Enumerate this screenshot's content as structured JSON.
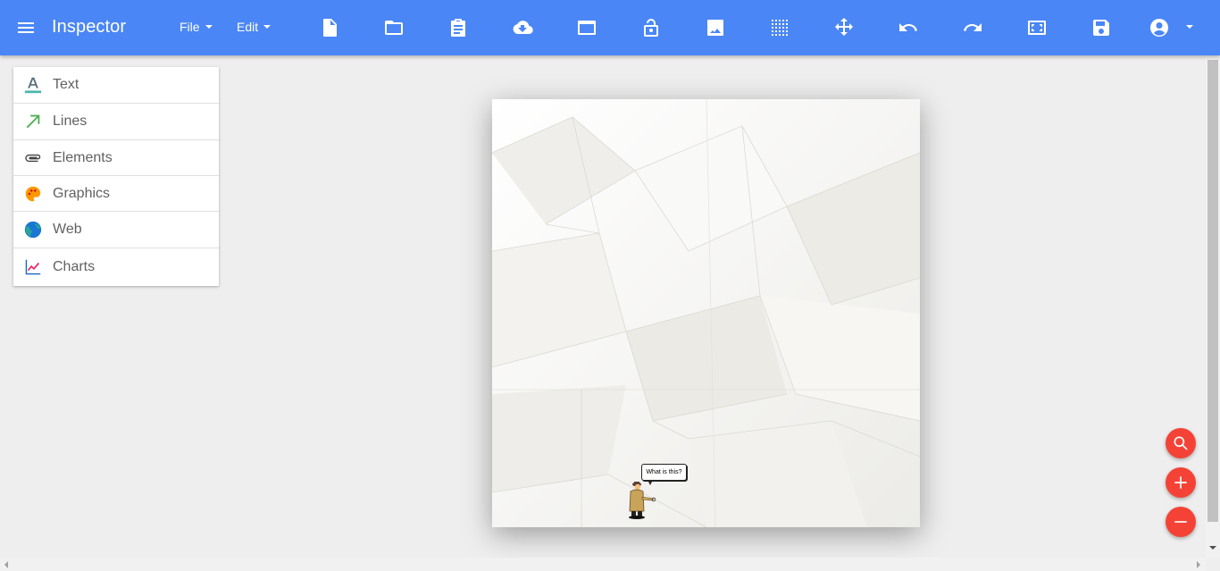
{
  "app": {
    "title": "Inspector"
  },
  "menus": {
    "file": "File",
    "edit": "Edit"
  },
  "toolbar": {
    "tools": [
      {
        "name": "new-document-icon"
      },
      {
        "name": "open-folder-icon"
      },
      {
        "name": "clipboard-icon"
      },
      {
        "name": "cloud-download-icon"
      },
      {
        "name": "window-icon"
      },
      {
        "name": "lock-open-icon"
      },
      {
        "name": "image-icon"
      },
      {
        "name": "grid-icon"
      },
      {
        "name": "move-icon"
      },
      {
        "name": "undo-icon"
      },
      {
        "name": "redo-icon"
      },
      {
        "name": "fit-screen-icon"
      },
      {
        "name": "save-icon"
      },
      {
        "name": "account-circle-icon"
      }
    ]
  },
  "sidebar": {
    "items": [
      {
        "label": "Text",
        "icon": "text-icon",
        "color": "#4db6ac"
      },
      {
        "label": "Lines",
        "icon": "arrow-line-icon",
        "color": "#4caf50"
      },
      {
        "label": "Elements",
        "icon": "paperclip-icon",
        "color": "#616161"
      },
      {
        "label": "Graphics",
        "icon": "palette-icon",
        "color": "#ff9800"
      },
      {
        "label": "Web",
        "icon": "globe-icon",
        "color": "#1976d2"
      },
      {
        "label": "Charts",
        "icon": "line-chart-icon",
        "color": "#e91e63"
      }
    ]
  },
  "canvas": {
    "speech_bubble": "What is this?"
  },
  "colors": {
    "toolbar": "#4a86f5",
    "fab": "#f44336",
    "paper": "#f6f5f2"
  }
}
